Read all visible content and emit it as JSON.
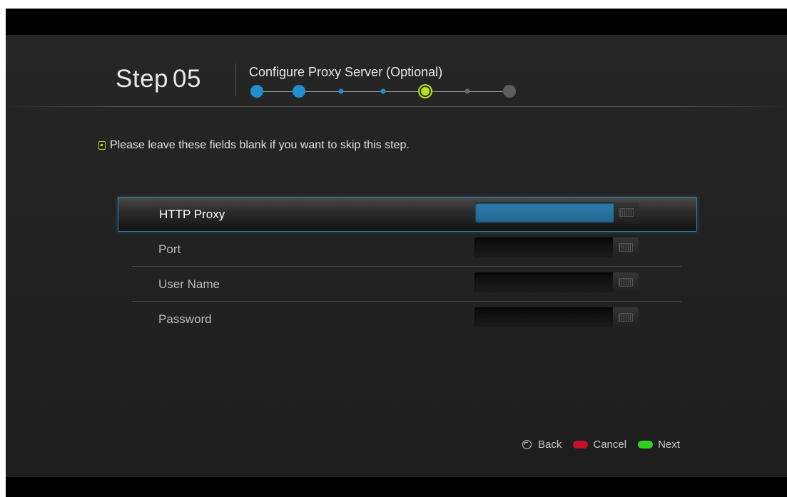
{
  "header": {
    "step_word": "Step",
    "step_number": "05",
    "title": "Configure Proxy Server (Optional)",
    "progress_total_steps": 7,
    "progress_current_step": 5
  },
  "notice": {
    "icon": "clipboard-icon",
    "text": "Please leave these fields blank if you want to skip this step."
  },
  "form": {
    "fields": [
      {
        "label": "HTTP Proxy",
        "value": "",
        "selected": true
      },
      {
        "label": "Port",
        "value": "",
        "selected": false
      },
      {
        "label": "User Name",
        "value": "",
        "selected": false
      },
      {
        "label": "Password",
        "value": "",
        "selected": false
      }
    ]
  },
  "legend": {
    "back_label": "Back",
    "cancel_label": "Cancel",
    "next_label": "Next"
  },
  "colors": {
    "accent_blue": "#1f8fd0",
    "current_step": "#b5e61d",
    "cancel": "#c0122a",
    "next": "#33d11f",
    "selection_border": "#3d7aa0"
  }
}
